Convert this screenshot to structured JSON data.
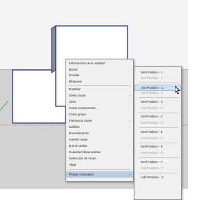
{
  "context_menu": [
    {
      "label": "Información de la entidad"
    },
    {
      "label": "Borrar"
    },
    {
      "label": "Ocultar"
    },
    {
      "label": "Bloquear"
    },
    {
      "label": "Explotar"
    },
    {
      "label": "Seleccionar",
      "submenu": true
    },
    {
      "label": "Área",
      "submenu": true
    },
    {
      "label": "Crear componente..."
    },
    {
      "label": "Crear grupo"
    },
    {
      "label": "Intersecar caras",
      "submenu": true
    },
    {
      "label": "Sólidos",
      "submenu": true
    },
    {
      "label": "Revolvimiento"
    },
    {
      "label": "Invertir caras"
    },
    {
      "label": "Dar la vuelta",
      "submenu": true
    },
    {
      "label": "Suavizar/Alisar aristas"
    },
    {
      "label": "Selección de zoom"
    },
    {
      "label": "Align"
    },
    {
      "label": "Proper Animation",
      "submenu": true
    }
  ],
  "submenu": [
    {
      "label": "Set Position - 1"
    },
    {
      "label": "Get Position - 1"
    },
    {
      "label": "Set Position - 2"
    },
    {
      "label": "Get Position - 2"
    },
    {
      "label": "Set Position - 3"
    },
    {
      "label": "Get Position - 3"
    },
    {
      "label": "Set Position - 4"
    },
    {
      "label": "Get Position - 4"
    },
    {
      "label": "Set Position - 5"
    },
    {
      "label": "Get Position - 5"
    },
    {
      "label": "Set Position - 6"
    },
    {
      "label": "Get Position - 6"
    },
    {
      "label": "Set Position - 7"
    },
    {
      "label": "Get Position - 7"
    },
    {
      "label": "Add Position - 0"
    }
  ],
  "icons": {
    "submenu_arrow": "chevron-right-icon",
    "cursor": "mouse-pointer-icon"
  },
  "colors": {
    "sky": "#f4f4f4",
    "ground": "#d2d2d2",
    "box_edge": "#1c2c8a",
    "highlight": "#cfe0f5",
    "axis_red": "#c84a3c",
    "axis_green": "#4caf50"
  }
}
